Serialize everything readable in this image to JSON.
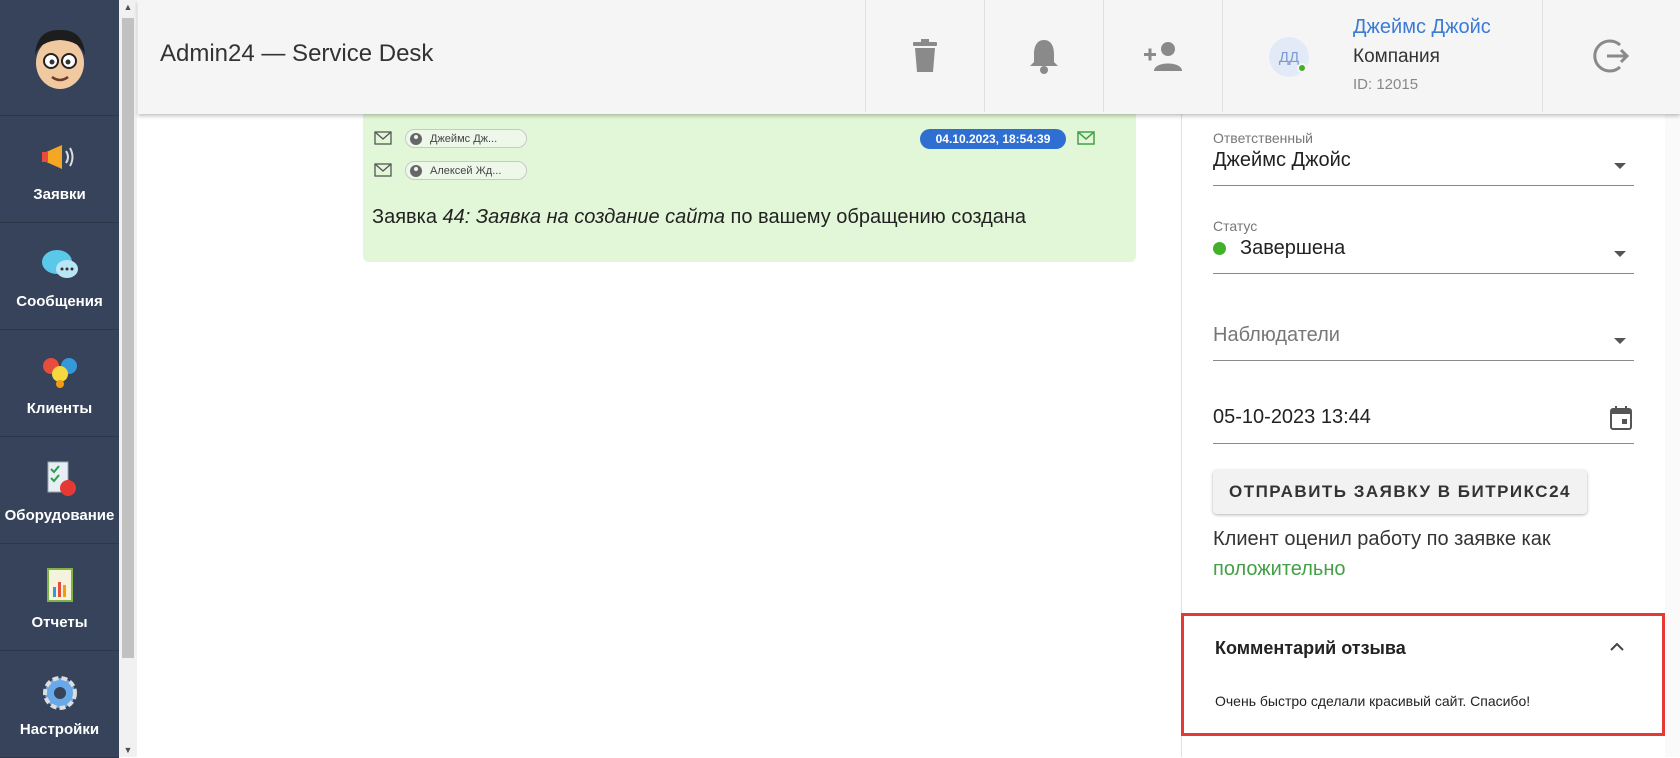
{
  "app": {
    "title": "Admin24 — Service Desk"
  },
  "sidebar": {
    "items": [
      {
        "label": "Заявки",
        "icon": "megaphone-icon"
      },
      {
        "label": "Сообщения",
        "icon": "chat-bubbles-icon"
      },
      {
        "label": "Клиенты",
        "icon": "people-icon"
      },
      {
        "label": "Оборудование",
        "icon": "equipment-icon"
      },
      {
        "label": "Отчеты",
        "icon": "report-icon"
      },
      {
        "label": "Настройки",
        "icon": "gear-icon"
      }
    ]
  },
  "header": {
    "buttons": [
      "trash-icon",
      "bell-icon",
      "add-user-icon",
      "logout-icon"
    ],
    "user": {
      "initials": "ДД",
      "name": "Джеймс Джойс",
      "company": "Компания",
      "id": "ID: 12015"
    }
  },
  "message": {
    "from": "Джеймс Дж...",
    "to": "Алексей Жд...",
    "date": "04.10.2023, 18:54:39",
    "text_prefix": "Заявка ",
    "text_italic": "44: Заявка на создание сайта",
    "text_suffix": " по вашему обращению создана"
  },
  "panel": {
    "responsible_label": "Ответственный",
    "responsible_value": "Джеймс Джойс",
    "status_label": "Статус",
    "status_value": "Завершена",
    "status_color": "#43b02a",
    "observers_placeholder": "Наблюдатели",
    "deadline_value": "05-10-2023 13:44",
    "send_button": "ОТПРАВИТЬ ЗАЯВКУ В БИТРИКС24",
    "rating_text": "Клиент оценил работу по заявке как",
    "rating_value": "положительно"
  },
  "review": {
    "title": "Комментарий отзыва",
    "text": "Очень быстро сделали красивый сайт. Спасибо!"
  }
}
